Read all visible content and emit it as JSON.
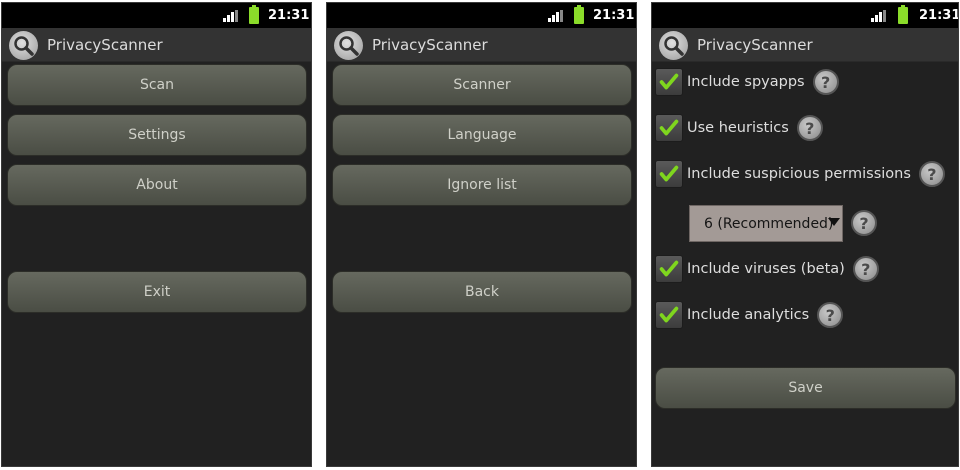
{
  "status": {
    "time": "21:31"
  },
  "app": {
    "title": "PrivacyScanner"
  },
  "screen1": {
    "buttons": [
      "Scan",
      "Settings",
      "About",
      "Exit"
    ]
  },
  "screen2": {
    "buttons": [
      "Scanner",
      "Language",
      "Ignore list",
      "Back"
    ]
  },
  "screen3": {
    "options": [
      {
        "label": "Include spyapps",
        "checked": true
      },
      {
        "label": "Use heuristics",
        "checked": true
      },
      {
        "label": "Include suspicious permissions",
        "checked": true
      },
      {
        "label": "Include viruses (beta)",
        "checked": true
      },
      {
        "label": "Include analytics",
        "checked": true
      }
    ],
    "dropdown_value": "6 (Recommended)",
    "help_glyph": "?",
    "save_label": "Save"
  },
  "colors": {
    "background": "#212121",
    "statusbar": "#000000",
    "checkmark": "#7fd61e",
    "button": "#5a5d53"
  },
  "icons": [
    "signal-icon",
    "battery-icon",
    "app-magnifier-icon",
    "help-icon",
    "checkmark-icon",
    "dropdown-caret-icon"
  ]
}
